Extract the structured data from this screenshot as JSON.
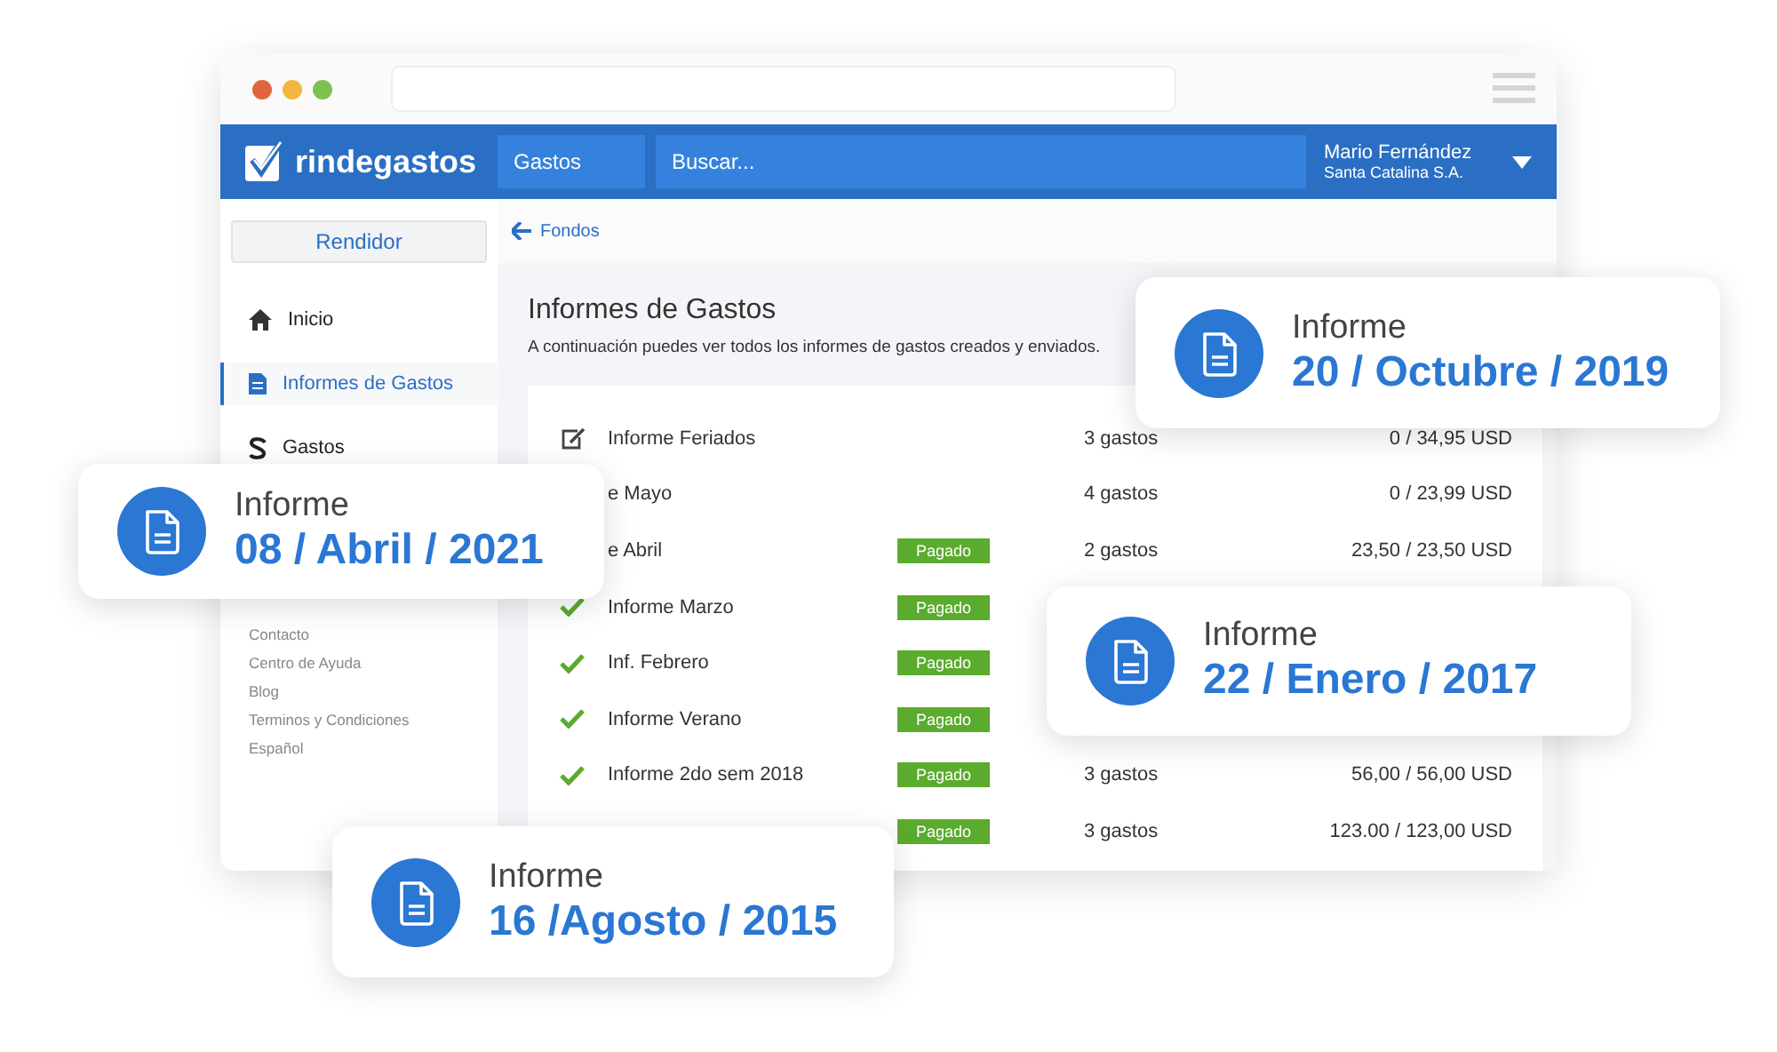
{
  "navbar": {
    "brand": "rindegastos",
    "section": "Gastos",
    "search": {
      "placeholder": "Buscar..."
    },
    "user": {
      "name": "Mario Fernández",
      "company": "Santa Catalina S.A."
    }
  },
  "sidebar": {
    "role_button": "Rendidor",
    "items": [
      {
        "label": "Inicio",
        "selected": false
      },
      {
        "label": "Informes de Gastos",
        "selected": true
      },
      {
        "label": "Gastos",
        "selected": false
      }
    ],
    "footer_links": [
      "Contacto",
      "Centro de Ayuda",
      "Blog",
      "Terminos y Condiciones",
      "Español"
    ]
  },
  "back_link": "Fondos",
  "page": {
    "title": "Informes de Gastos",
    "subtitle": "A continuación puedes ver todos los informes de gastos creados y enviados."
  },
  "reports": [
    {
      "kind": "draft",
      "name": "Informe Feriados",
      "count": "3 gastos",
      "amount": "0 / 34,95 USD"
    },
    {
      "name": "e Mayo",
      "count": "4 gastos",
      "amount": "0 / 23,99 USD"
    },
    {
      "name": "e Abril",
      "badge": "Pagado",
      "count": "2 gastos",
      "amount": "23,50 / 23,50 USD"
    },
    {
      "kind": "paid",
      "name": "Informe Marzo",
      "badge": "Pagado"
    },
    {
      "kind": "paid",
      "name": "Inf. Febrero",
      "badge": "Pagado"
    },
    {
      "kind": "paid",
      "name": "Informe Verano",
      "badge": "Pagado"
    },
    {
      "kind": "paid",
      "name": "Informe 2do sem 2018",
      "badge": "Pagado",
      "count": "3 gastos",
      "amount": "56,00 / 56,00 USD"
    },
    {
      "badge": "Pagado",
      "count": "3 gastos",
      "amount": "123.00 / 123,00 USD"
    }
  ],
  "floating_cards": [
    {
      "label": "Informe",
      "date": "20 / Octubre / 2019"
    },
    {
      "label": "Informe",
      "date": "08 / Abril / 2021"
    },
    {
      "label": "Informe",
      "date": "22 / Enero / 2017"
    },
    {
      "label": "Informe",
      "date": "16 /Agosto / 2015"
    }
  ]
}
